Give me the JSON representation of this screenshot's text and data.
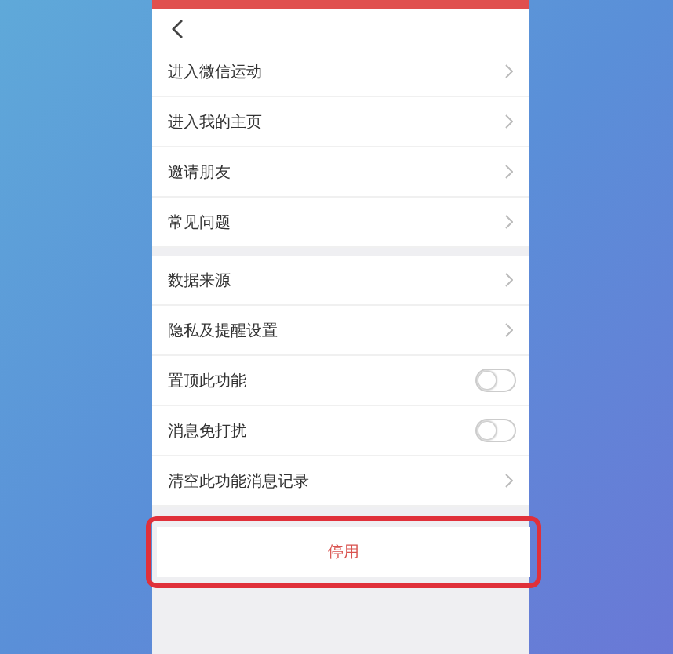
{
  "groups": [
    {
      "items": [
        {
          "kind": "link",
          "label": "进入微信运动"
        },
        {
          "kind": "link",
          "label": "进入我的主页"
        },
        {
          "kind": "link",
          "label": "邀请朋友"
        },
        {
          "kind": "link",
          "label": "常见问题"
        }
      ]
    },
    {
      "items": [
        {
          "kind": "link",
          "label": "数据来源"
        },
        {
          "kind": "link",
          "label": "隐私及提醒设置"
        },
        {
          "kind": "toggle",
          "label": "置顶此功能",
          "on": false
        },
        {
          "kind": "toggle",
          "label": "消息免打扰",
          "on": false
        },
        {
          "kind": "link",
          "label": "清空此功能消息记录"
        }
      ]
    }
  ],
  "disable_button": {
    "label": "停用",
    "highlighted": true
  }
}
